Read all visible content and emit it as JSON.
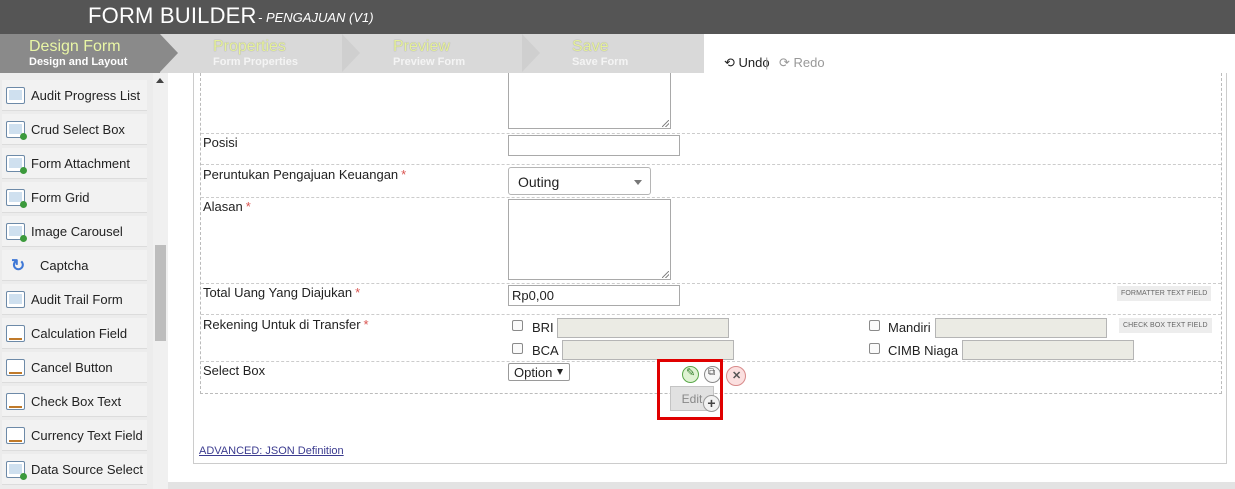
{
  "header": {
    "title": "FORM BUILDER",
    "subtitle": "- PENGAJUAN (V1)"
  },
  "steps": [
    {
      "label": "Design Form",
      "sub": "Design and Layout",
      "active": true
    },
    {
      "label": "Properties",
      "sub": "Form Properties",
      "active": false
    },
    {
      "label": "Preview",
      "sub": "Preview Form",
      "active": false
    },
    {
      "label": "Save",
      "sub": "Save Form",
      "active": false
    }
  ],
  "history": {
    "undo_label": "Undo",
    "separator": "|",
    "redo_label": "Redo"
  },
  "palette": [
    {
      "label": "Audit Progress List",
      "icon": "grid-icon"
    },
    {
      "label": "Crud Select Box",
      "icon": "select-box-icon"
    },
    {
      "label": "Form Attachment",
      "icon": "attachment-icon"
    },
    {
      "label": "Form Grid",
      "icon": "form-grid-icon"
    },
    {
      "label": "Image Carousel",
      "icon": "carousel-icon"
    },
    {
      "label": "Captcha",
      "icon": "recaptcha-icon"
    },
    {
      "label": "Audit Trail Form",
      "icon": "grid-icon"
    },
    {
      "label": "Calculation Field",
      "icon": "text-field-icon"
    },
    {
      "label": "Cancel Button",
      "icon": "text-field-icon"
    },
    {
      "label": "Check Box Text",
      "icon": "text-field-icon"
    },
    {
      "label": "Currency Text Field",
      "icon": "text-field-icon"
    },
    {
      "label": "Data Source Select",
      "icon": "select-box-icon"
    }
  ],
  "form": {
    "posisi_label": "Posisi",
    "peruntukan_label": "Peruntukan Pengajuan Keuangan",
    "peruntukan_value": "Outing",
    "alasan_label": "Alasan",
    "total_label": "Total Uang Yang Diajukan",
    "total_value": "Rp0,00",
    "total_type": "FORMATTER TEXT FIELD",
    "rekening_label": "Rekening Untuk di Transfer",
    "rekening_type": "CHECK BOX TEXT FIELD",
    "banks": [
      "BRI",
      "BCA",
      "Mandiri",
      "CIMB Niaga"
    ],
    "selectbox_label": "Select Box",
    "selectbox_value": "Option",
    "required_mark": "*"
  },
  "tooltip": {
    "edit_label": "Edit"
  },
  "footer": {
    "advanced_link": "ADVANCED: JSON Definition"
  },
  "colors": {
    "header_bg": "#555555",
    "step_active_bg": "#8a8a8a",
    "step_label": "#e9f6a6",
    "required": "#d9534f",
    "highlight": "#e00000"
  }
}
